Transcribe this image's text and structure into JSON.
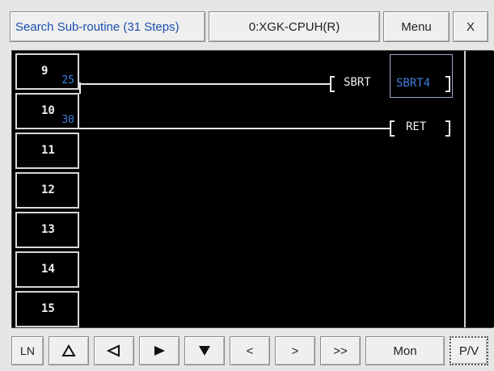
{
  "header": {
    "title": "Search Sub-routine (31 Steps)",
    "cpu": "0:XGK-CPUH(R)",
    "menu": "Menu",
    "close": "X"
  },
  "rows": [
    {
      "line": "9",
      "step": "25"
    },
    {
      "line": "10",
      "step": "30"
    },
    {
      "line": "11",
      "step": ""
    },
    {
      "line": "12",
      "step": ""
    },
    {
      "line": "13",
      "step": ""
    },
    {
      "line": "14",
      "step": ""
    },
    {
      "line": "15",
      "step": ""
    }
  ],
  "rungs": {
    "row9_instruction": "SBRT",
    "row9_operand": "SBRT4",
    "row10_instruction": "RET"
  },
  "colors": {
    "step_number": "#3f7fe0",
    "operand_selected": "#3f7fe0"
  },
  "footer": {
    "ln": "LN",
    "up": "up-triangle",
    "left": "left-triangle",
    "right": "right-triangle",
    "down": "down-triangle",
    "prev": "<",
    "next": ">",
    "fast_next": ">>",
    "mon": "Mon",
    "pv": "P/V"
  }
}
